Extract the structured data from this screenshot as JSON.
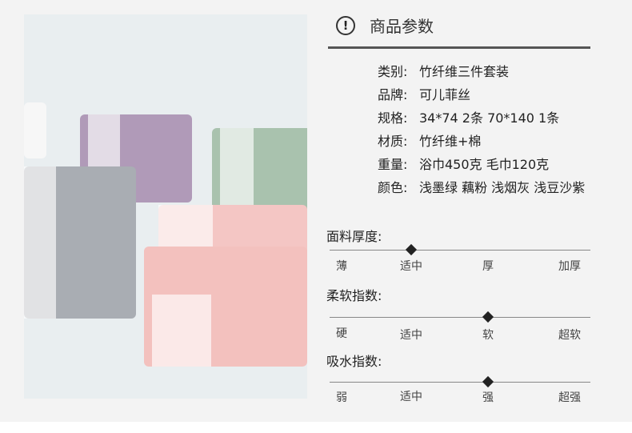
{
  "section_title": "商品参数",
  "specs": [
    {
      "label": "类别:",
      "value": "竹纤维三件套装"
    },
    {
      "label": "品牌:",
      "value": "可儿菲丝"
    },
    {
      "label": "规格:",
      "value": "34*74 2条 70*140 1条"
    },
    {
      "label": "材质:",
      "value": "竹纤维+棉"
    },
    {
      "label": "重量:",
      "value": "浴巾450克  毛巾120克"
    },
    {
      "label": "颜色:",
      "value": "浅墨绿  藕粉  浅烟灰 浅豆沙紫"
    }
  ],
  "scales": [
    {
      "title": "面料厚度:",
      "ticks": [
        "薄",
        "适中",
        "厚",
        "加厚"
      ],
      "selected_index": 1
    },
    {
      "title": "柔软指数:",
      "ticks": [
        "硬",
        "适中",
        "软",
        "超软"
      ],
      "selected_index": 2
    },
    {
      "title": "吸水指数:",
      "ticks": [
        "弱",
        "适中",
        "强",
        "超强"
      ],
      "selected_index": 2
    }
  ],
  "photo": {
    "description_icon": "towel-set-photo"
  }
}
